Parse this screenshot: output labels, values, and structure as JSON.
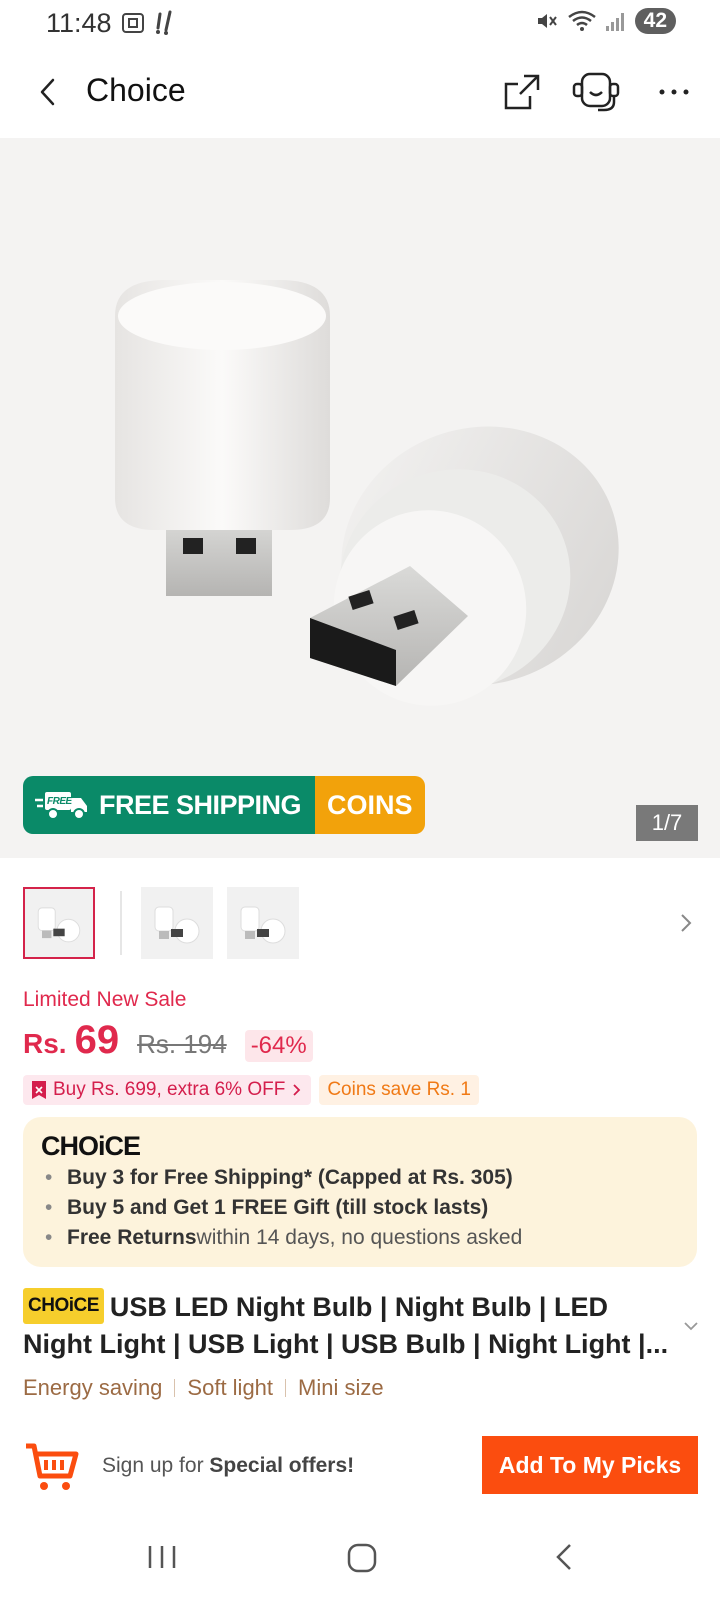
{
  "status_bar": {
    "time": "11:48",
    "battery": "42",
    "icons": [
      "screenshot-icon",
      "notification-icon",
      "mute-icon",
      "wifi-icon",
      "signal-icon"
    ]
  },
  "header": {
    "title": "Choice",
    "icons": [
      "back-icon",
      "share-icon",
      "support-icon",
      "more-icon"
    ]
  },
  "gallery": {
    "banner_left": "FREE SHIPPING",
    "banner_right": "COINS",
    "banner_badge": "FREE",
    "counter": "1/7"
  },
  "pricing": {
    "sale_label": "Limited New Sale",
    "currency": "Rs.",
    "price": "69",
    "original_price": "Rs. 194",
    "discount": "-64%",
    "promo_tag": "Buy Rs. 699, extra 6% OFF",
    "coin_tag": "Coins save Rs. 1"
  },
  "choice_box": {
    "logo": "CHOiCE",
    "benefits": [
      {
        "bold": "Buy 3 for  Free Shipping* (Capped at Rs. 305)",
        "rest": ""
      },
      {
        "bold": "Buy 5 and Get 1 FREE Gift (till stock lasts)",
        "rest": ""
      },
      {
        "bold": "Free Returns",
        "rest": " within 14 days, no questions asked"
      }
    ]
  },
  "product": {
    "badge": "CHOiCE",
    "title": "USB LED Night Bulb | Night Bulb | LED Night Light | USB Light | USB Bulb | Night Light |...",
    "tags": [
      "Energy saving",
      "Soft light",
      "Mini size"
    ]
  },
  "bottom_bar": {
    "signup_prefix": "Sign up for ",
    "signup_bold": "Special offers!",
    "add_button": "Add To My Picks"
  },
  "colors": {
    "accent_red": "#e0294d",
    "cta_orange": "#fb4d0f",
    "shipping_green": "#0a8a68",
    "coins_orange": "#f2a20b",
    "choice_yellow": "#f6ce2c"
  }
}
